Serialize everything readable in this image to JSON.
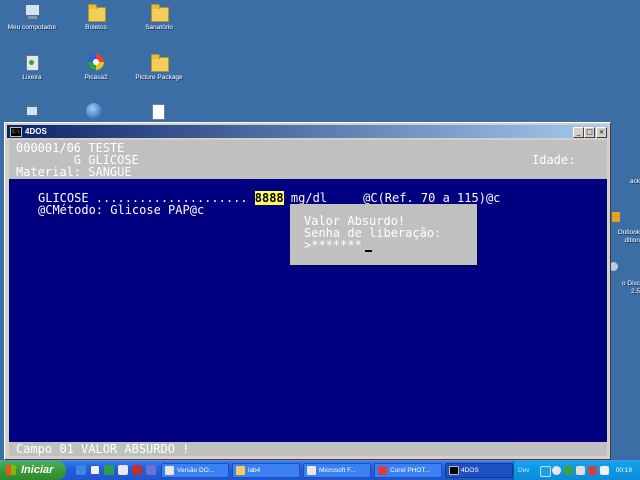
{
  "desktop": {
    "icons": [
      {
        "label": "Meu computador",
        "icon": "computer-icon"
      },
      {
        "label": "Boletos",
        "icon": "folder-icon"
      },
      {
        "label": "Sanatório",
        "icon": "folder-icon"
      },
      {
        "label": "Lixeira",
        "icon": "recycle-bin-icon"
      },
      {
        "label": "Picasa2",
        "icon": "picasa-icon"
      },
      {
        "label": "Picture Package",
        "icon": "folder-icon"
      }
    ],
    "edge_labels": [
      "ack",
      "Outlook",
      "dition",
      "o Disc",
      "2.5"
    ]
  },
  "window": {
    "title": "4DOS",
    "console": {
      "line1": "000001/06 TESTE",
      "line2": "        G GLICOSE",
      "idade_label": "Idade:",
      "material_label": "Material: SANGUE",
      "result_prefix": "GLICOSE .....................",
      "result_value": "8888",
      "result_suffix": "mg/dl     @C(Ref. 70 a 115)@c",
      "method_line": "@CMétodo: Glicose PAP@c",
      "status_line": "Campo 01 VALOR ABSURDO !"
    },
    "dialog": {
      "line1": "Valor Absurdo!",
      "line2": "Senha de liberação:",
      "line3": ">*******"
    }
  },
  "taskbar": {
    "start_label": "Iniciar",
    "tasks": [
      {
        "label": "Versão DO...",
        "active": false
      },
      {
        "label": "lab4",
        "active": false
      },
      {
        "label": "Microsoft F...",
        "active": false
      },
      {
        "label": "Corel PHOT...",
        "active": false
      },
      {
        "label": "4DOS",
        "active": true
      }
    ],
    "tray_label": "Dev",
    "clock": "00:19"
  },
  "colors": {
    "console_bg": "#000080",
    "console_gray": "#c0c0c0",
    "desktop_bg": "#3a6ea5",
    "value_highlight": "#ffff55"
  }
}
